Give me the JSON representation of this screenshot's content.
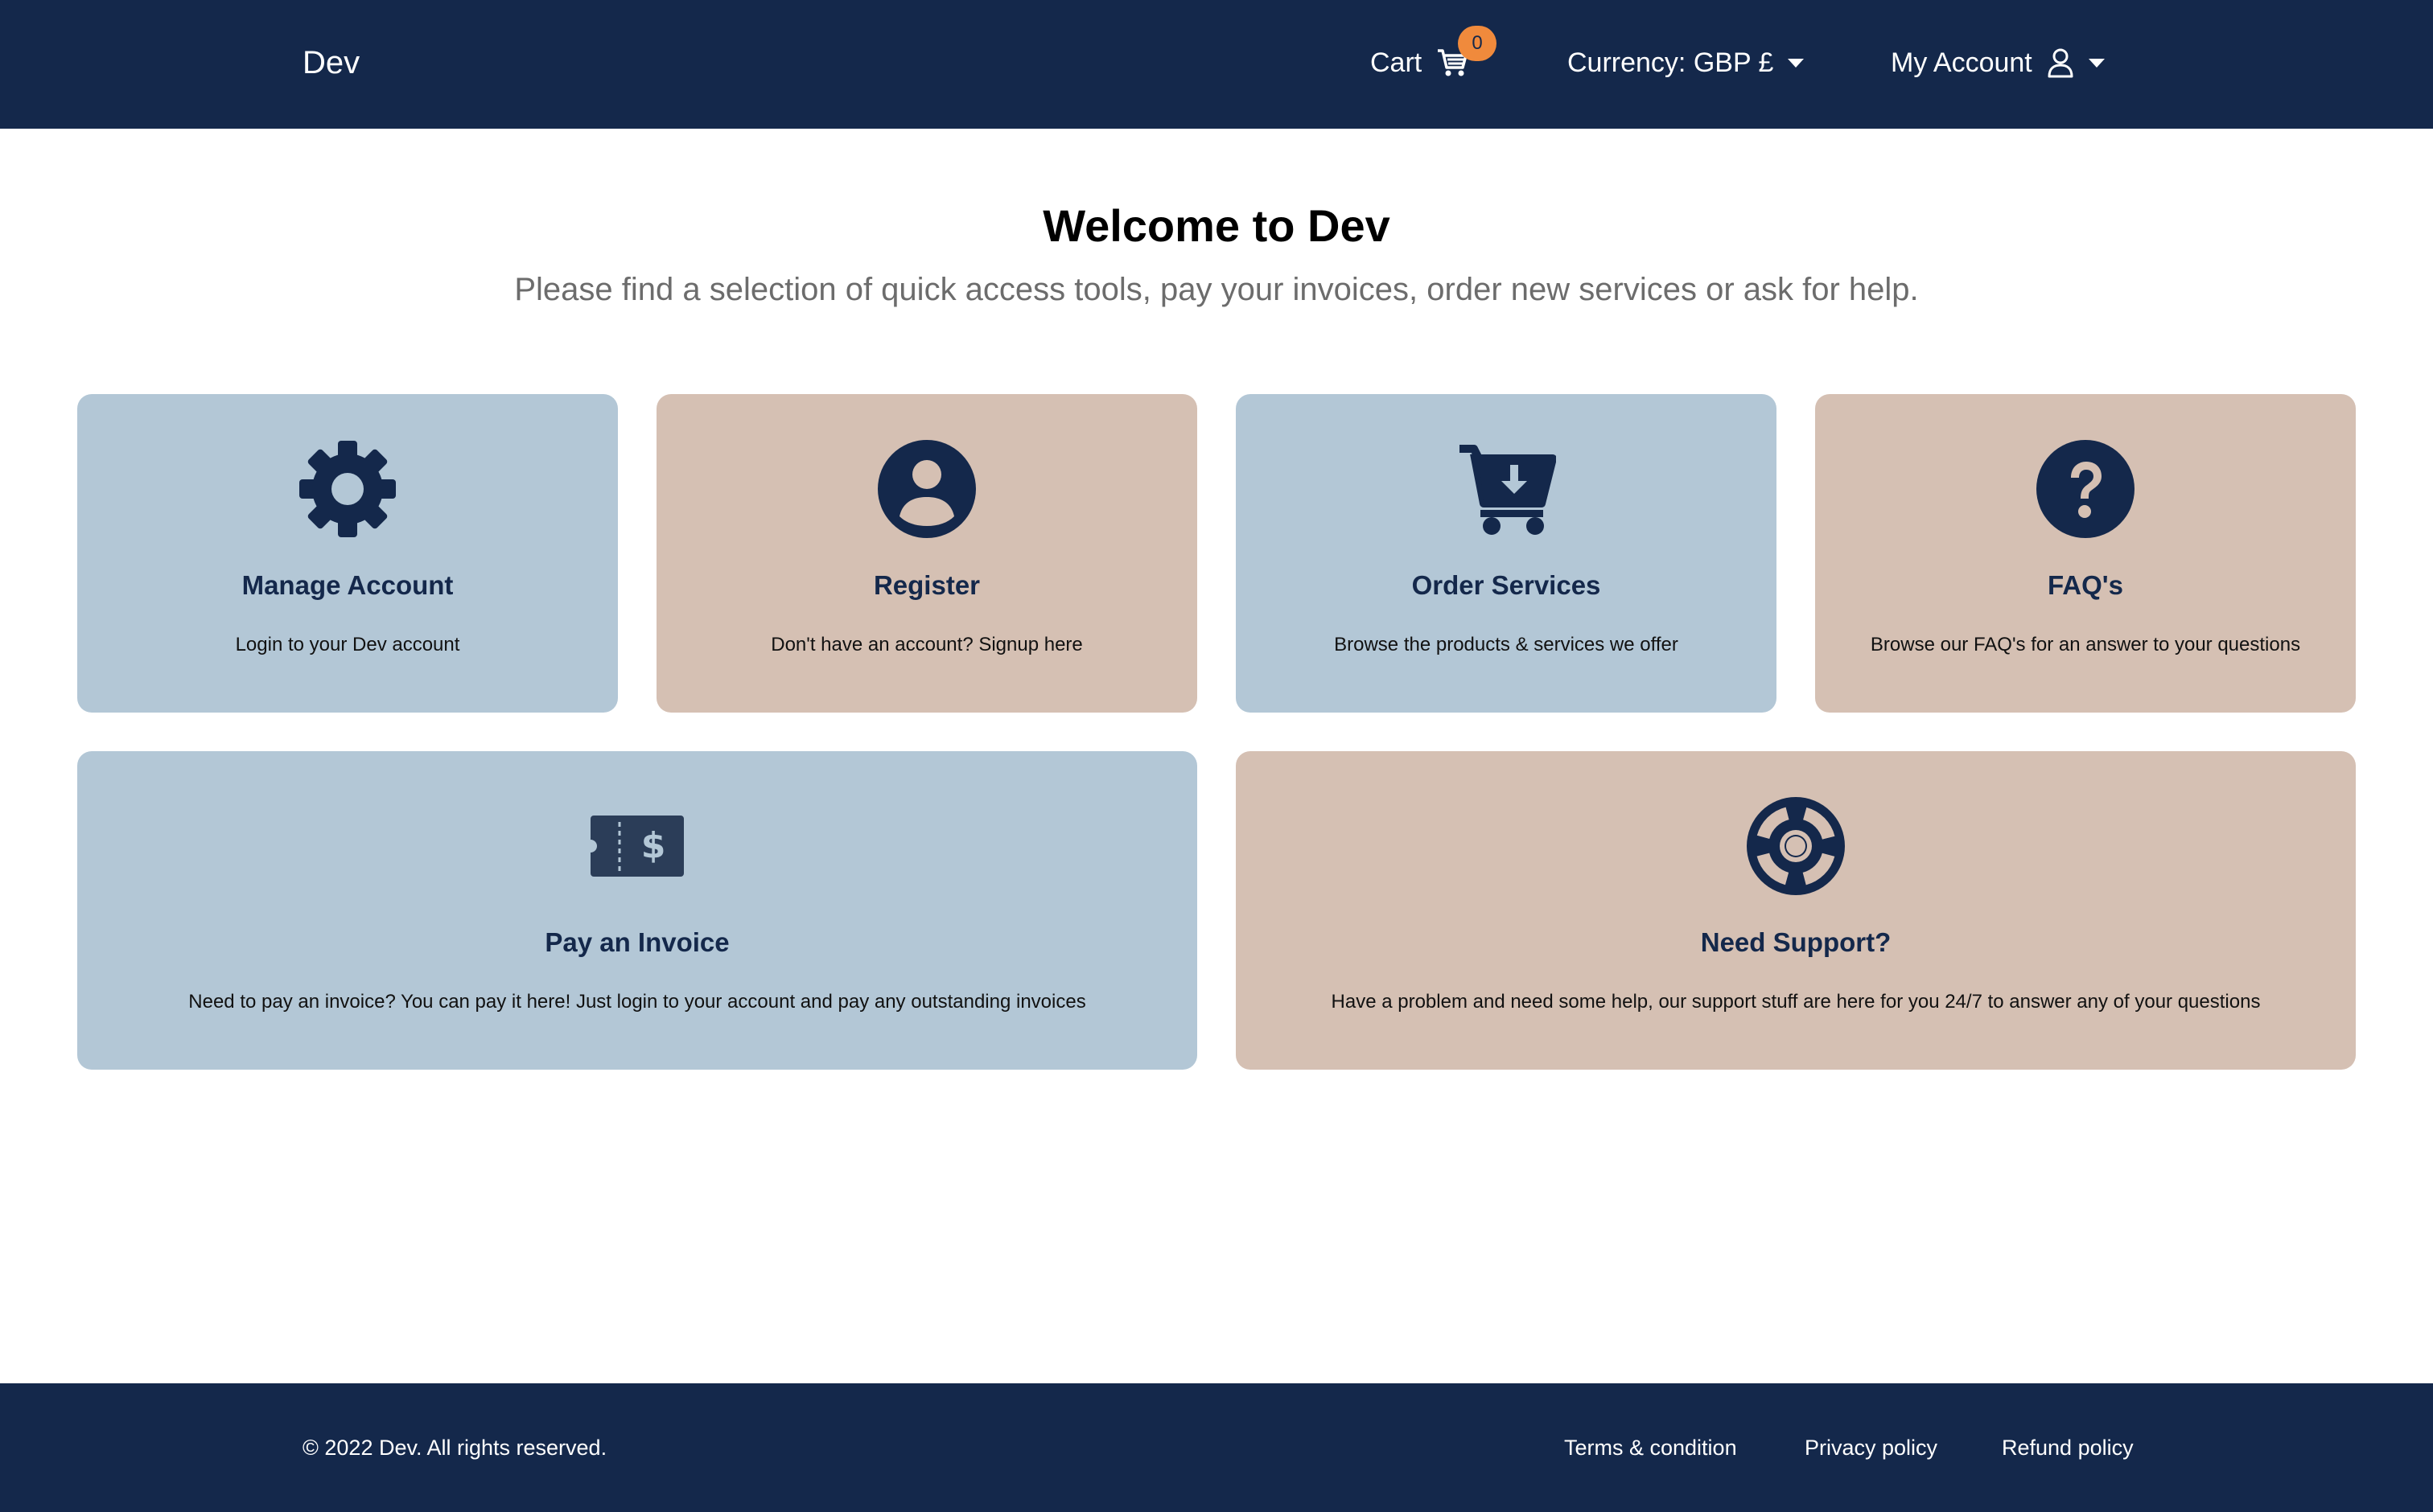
{
  "header": {
    "brand": "Dev",
    "cart_label": "Cart",
    "cart_count": "0",
    "currency_label": "Currency: GBP £",
    "account_label": "My Account"
  },
  "hero": {
    "title": "Welcome to Dev",
    "subtitle": "Please find a selection of quick access tools, pay your invoices, order new services or ask for help."
  },
  "cards": [
    {
      "title": "Manage Account",
      "desc": "Login to your Dev account",
      "icon": "gear-icon"
    },
    {
      "title": "Register",
      "desc": "Don't have an account? Signup here",
      "icon": "user-circle-icon"
    },
    {
      "title": "Order Services",
      "desc": "Browse the products & services we offer",
      "icon": "cart-download-icon"
    },
    {
      "title": "FAQ's",
      "desc": "Browse our FAQ's for an answer to your questions",
      "icon": "question-circle-icon"
    },
    {
      "title": "Pay an Invoice",
      "desc": "Need to pay an invoice? You can pay it here! Just login to your account and pay any outstanding invoices",
      "icon": "ticket-dollar-icon"
    },
    {
      "title": "Need Support?",
      "desc": "Have a problem and need some help, our support stuff are here for you 24/7 to answer any of your questions",
      "icon": "life-ring-icon"
    }
  ],
  "colors": {
    "navy": "#14284b",
    "card_blue": "#b3c7d6",
    "card_tan": "#d5c0b3",
    "badge_orange": "#f08a3c"
  },
  "footer": {
    "copyright": "© 2022 Dev. All rights reserved.",
    "links": [
      "Terms & condition",
      "Privacy policy",
      "Refund policy"
    ]
  }
}
